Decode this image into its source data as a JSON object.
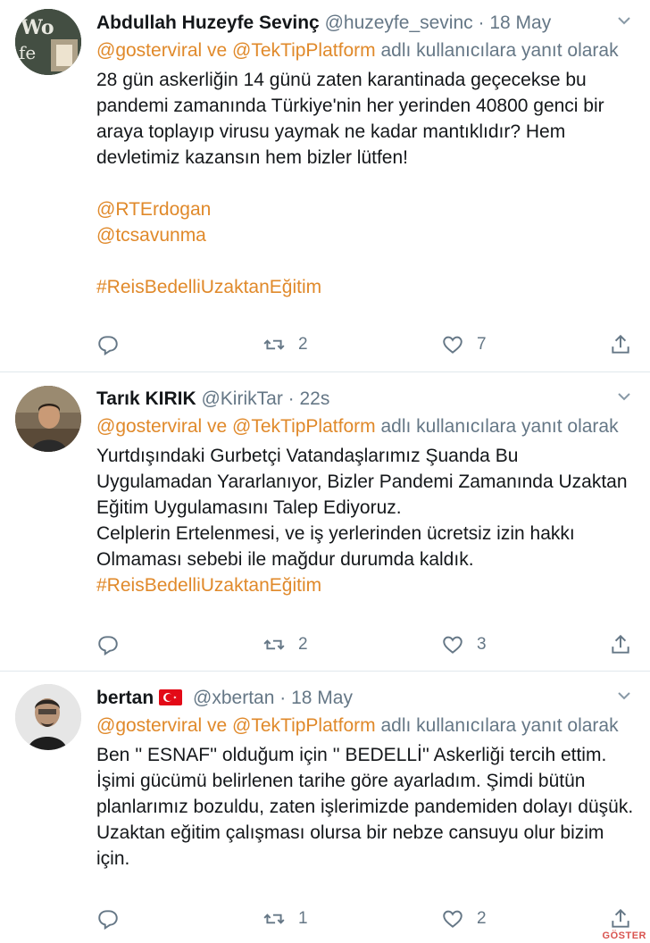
{
  "tweets": [
    {
      "name": "Abdullah Huzeyfe Sevinç",
      "handle": "@huzeyfe_sevinc",
      "time": "18 May",
      "reply_mentions": "@gosterviral ve @TekTipPlatform",
      "reply_suffix": " adlı kullanıcılara yanıt olarak",
      "body": "28 gün askerliğin 14 günü zaten karantinada geçecekse bu pandemi zamanında Türkiye'nin her yerinden 40800 genci bir araya toplayıp virusu yaymak ne kadar mantıklıdır? Hem devletimiz kazansın hem bizler lütfen!",
      "mention1": "@RTErdogan",
      "mention2": "@tcsavunma",
      "hashtag": "#ReisBedelliUzaktanEğitim",
      "retweets": "2",
      "likes": "7"
    },
    {
      "name": "Tarık KIRIK",
      "handle": "@KirikTar",
      "time": "22s",
      "reply_mentions": "@gosterviral ve @TekTipPlatform",
      "reply_suffix": " adlı kullanıcılara yanıt olarak",
      "body_lines": [
        "Yurtdışındaki Gurbetçi Vatandaşlarımız Şuanda Bu Uygulamadan Yararlanıyor, Bizler Pandemi Zamanında Uzaktan Eğitim Uygulamasını Talep Ediyoruz.",
        "Celplerin Ertelenmesi, ve iş yerlerinden ücretsiz izin hakkı Olmaması sebebi ile mağdur durumda kaldık."
      ],
      "hashtag": "#ReisBedelliUzaktanEğitim",
      "retweets": "2",
      "likes": "3"
    },
    {
      "name": "bertan",
      "handle": "@xbertan",
      "time": "18 May",
      "reply_mentions": "@gosterviral ve @TekTipPlatform",
      "reply_suffix": " adlı kullanıcılara yanıt olarak",
      "body": "Ben '' ESNAF'' olduğum için '' BEDELLİ'' Askerliği tercih ettim. İşimi gücümü belirlenen tarihe göre ayarladım. Şimdi bütün planlarımız bozuldu, zaten işlerimizde pandemiden dolayı düşük. Uzaktan eğitim çalışması olursa bir nebze cansuyu olur bizim için.",
      "retweets": "1",
      "likes": "2"
    }
  ],
  "separator": "·",
  "watermark": "GÖSTER",
  "colors": {
    "accent": "#e0892a",
    "muted": "#657786",
    "text": "#14171a",
    "divider": "#e1e8ed"
  },
  "icons": {
    "reply": "reply-icon",
    "retweet": "retweet-icon",
    "like": "heart-icon",
    "share": "share-icon",
    "more": "chevron-down-icon"
  }
}
